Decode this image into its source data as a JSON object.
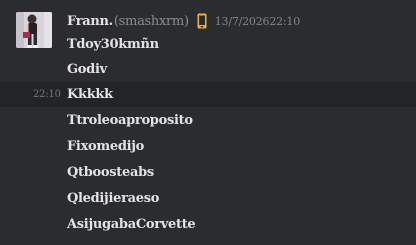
{
  "author": {
    "display_name": "Frann.",
    "handle": "(smashxrm)",
    "avatar_icon": "user-avatar",
    "device_icon": "mobile-phone-icon",
    "timestamp": "13/7/202622:10"
  },
  "colors": {
    "background": "#2b2c30",
    "hover_row": "#232427",
    "text": "#e3e3e6",
    "muted": "#8b8c91",
    "mobile_icon": "#f0b232"
  },
  "hovered_time": "22:10",
  "messages": [
    {
      "text": "Tdoy30kmñn"
    },
    {
      "text": "Godiv"
    },
    {
      "text": "Kkkkk"
    },
    {
      "text": "Ttroleoaproposito"
    },
    {
      "text": "Fixomedijo"
    },
    {
      "text": "Qtboosteabs"
    },
    {
      "text": "Qledijieraeso"
    },
    {
      "text": "AsijugabaCorvette"
    }
  ]
}
